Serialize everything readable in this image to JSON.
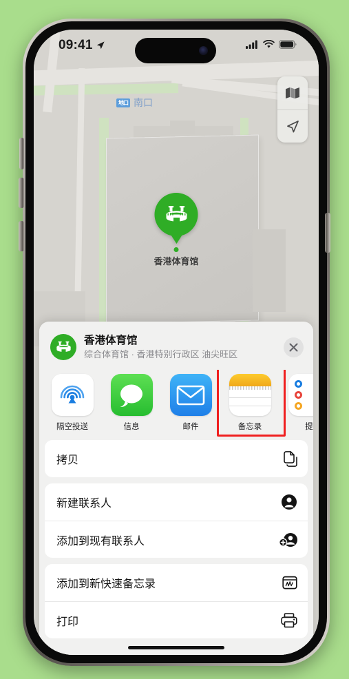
{
  "wallpaper_color": "#a9dd8c",
  "status_bar": {
    "time": "09:41",
    "location_arrow_icon": "location-arrow-icon",
    "cellular_icon": "cellular-bars-icon",
    "wifi_icon": "wifi-icon",
    "battery_icon": "battery-full-icon"
  },
  "map": {
    "metro_label": "南口",
    "metro_badge": "地口",
    "pin_label": "香港体育馆",
    "pin_color": "#2fad26",
    "controls": [
      {
        "name": "map-layers-button",
        "icon": "map-icon"
      },
      {
        "name": "locate-me-button",
        "icon": "navigation-arrow-icon"
      }
    ]
  },
  "share_sheet": {
    "title": "香港体育馆",
    "subtitle": "综合体育馆 · 香港特别行政区 油尖旺区",
    "place_icon": "stadium-icon",
    "close_label": "×",
    "apps": [
      {
        "label": "隔空投送",
        "icon": "airdrop-icon",
        "highlighted": false
      },
      {
        "label": "信息",
        "icon": "messages-icon",
        "highlighted": false
      },
      {
        "label": "邮件",
        "icon": "mail-icon",
        "highlighted": false
      },
      {
        "label": "备忘录",
        "icon": "notes-icon",
        "highlighted": true
      },
      {
        "label": "提",
        "icon": "reminders-icon",
        "highlighted": false
      }
    ],
    "highlight_color": "#f01f1f",
    "action_groups": [
      {
        "rows": [
          {
            "label": "拷贝",
            "icon": "copy-icon"
          }
        ]
      },
      {
        "rows": [
          {
            "label": "新建联系人",
            "icon": "person-circle-icon"
          },
          {
            "label": "添加到现有联系人",
            "icon": "person-add-icon"
          }
        ]
      },
      {
        "rows": [
          {
            "label": "添加到新快速备忘录",
            "icon": "quick-note-icon"
          },
          {
            "label": "打印",
            "icon": "printer-icon"
          }
        ]
      }
    ]
  }
}
